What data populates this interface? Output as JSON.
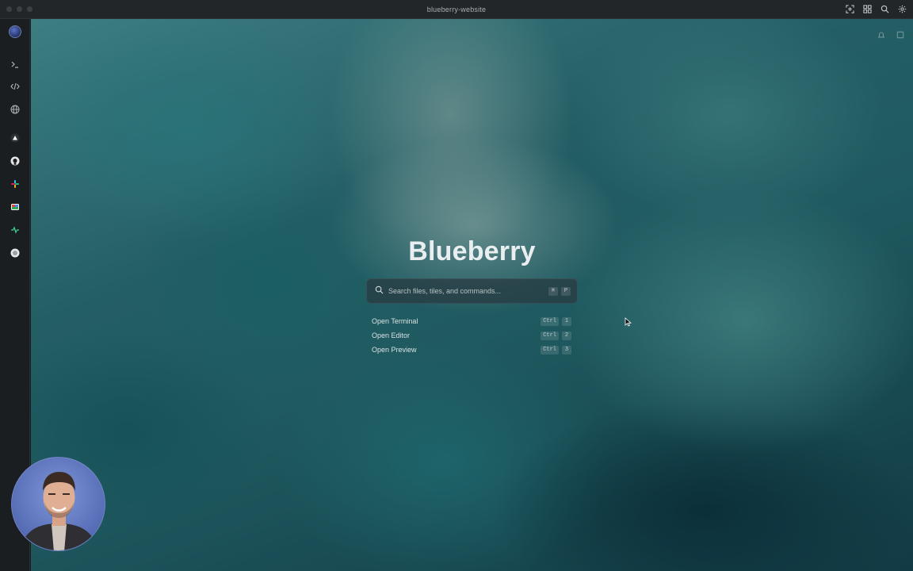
{
  "window": {
    "title": "blueberry-website"
  },
  "titlebar_actions": [
    {
      "name": "focus-icon"
    },
    {
      "name": "grid-icon"
    },
    {
      "name": "search-icon"
    },
    {
      "name": "settings-icon"
    }
  ],
  "sidebar": {
    "items": [
      {
        "name": "app-avatar-icon"
      },
      {
        "name": "terminal-icon"
      },
      {
        "name": "code-icon"
      },
      {
        "name": "globe-icon"
      },
      {
        "name": "vercel-icon"
      },
      {
        "name": "github-icon"
      },
      {
        "name": "slack-icon"
      },
      {
        "name": "figma-icon"
      },
      {
        "name": "activity-icon"
      },
      {
        "name": "circle-app-icon"
      }
    ]
  },
  "main": {
    "brand": "Blueberry",
    "search": {
      "placeholder": "Search files, tiles, and commands...",
      "shortcut": [
        "⌘",
        "P"
      ]
    },
    "actions": [
      {
        "label": "Open Terminal",
        "keys": [
          "Ctrl",
          "1"
        ]
      },
      {
        "label": "Open Editor",
        "keys": [
          "Ctrl",
          "2"
        ]
      },
      {
        "label": "Open Preview",
        "keys": [
          "Ctrl",
          "3"
        ]
      }
    ]
  },
  "colors": {
    "accent": "#5b73c9",
    "background": "#1c1f22",
    "text": "#e9eff1"
  }
}
